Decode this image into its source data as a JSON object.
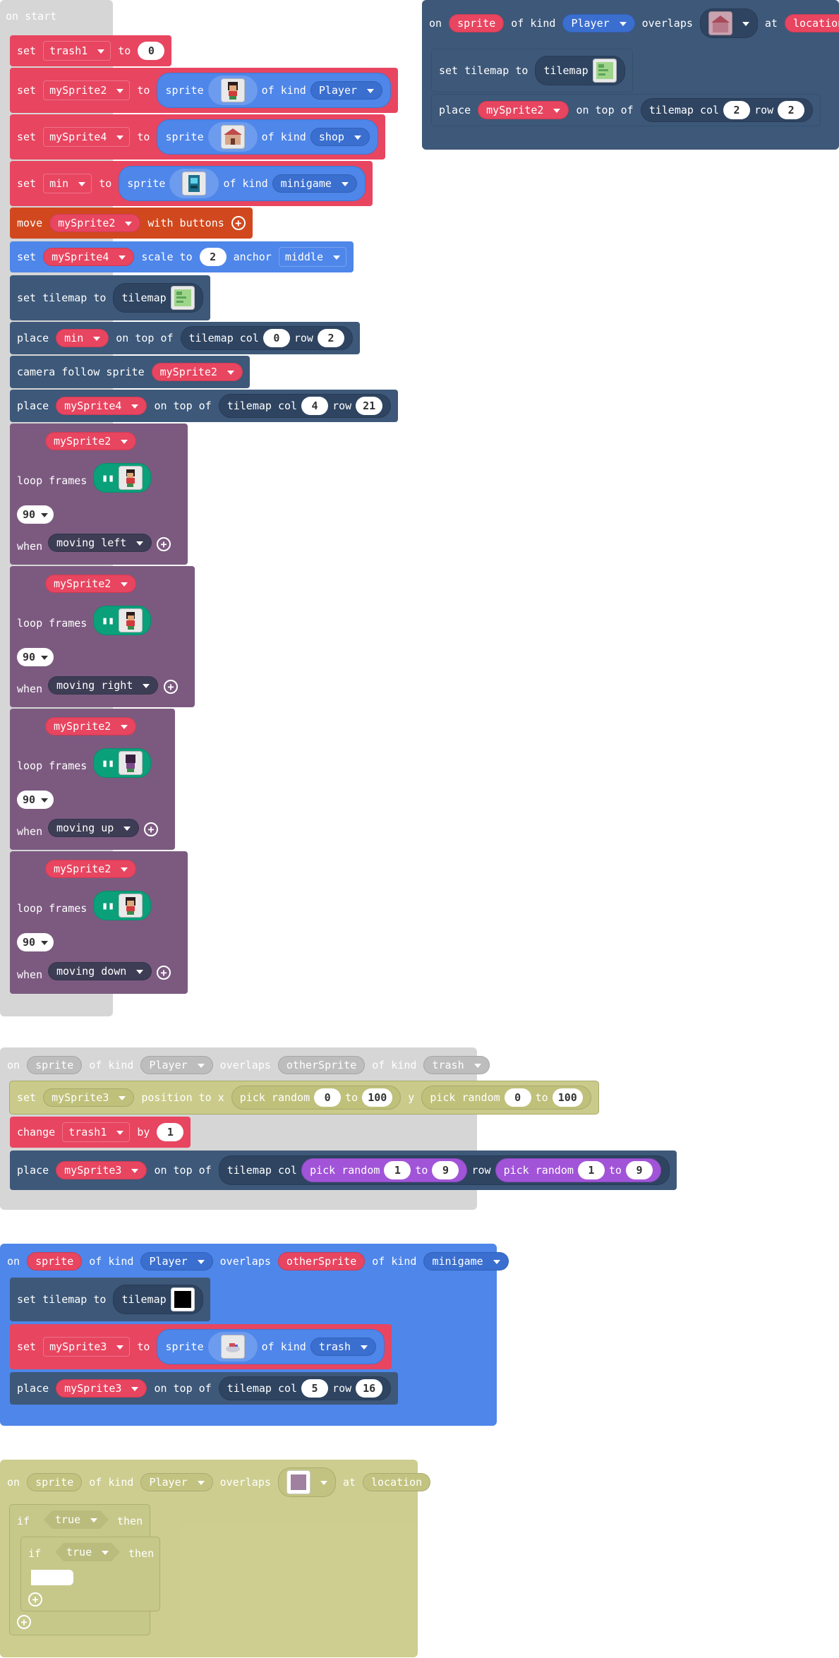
{
  "colors": {
    "red": "#e84560",
    "blue": "#4e86ea",
    "dark_blue": "#3d5879",
    "orange": "#d1481e",
    "purple": "#7c5a80",
    "green": "#0aa07a",
    "olive": "#cacb8a",
    "gray": "#d6d6d6"
  },
  "on_start": {
    "title": "on start",
    "set_trash": {
      "set": "set",
      "var": "trash1",
      "to": "to",
      "value": "0"
    },
    "set_mysprite2": {
      "set": "set",
      "var": "mySprite2",
      "to": "to",
      "sprite": "sprite",
      "of_kind": "of kind",
      "kind": "Player"
    },
    "set_mysprite4": {
      "set": "set",
      "var": "mySprite4",
      "to": "to",
      "sprite": "sprite",
      "of_kind": "of kind",
      "kind": "shop"
    },
    "set_min": {
      "set": "set",
      "var": "min",
      "to": "to",
      "sprite": "sprite",
      "of_kind": "of kind",
      "kind": "minigame"
    },
    "move": {
      "move": "move",
      "var": "mySprite2",
      "with": "with buttons"
    },
    "scale": {
      "set": "set",
      "var": "mySprite4",
      "scale_to": "scale to",
      "value": "2",
      "anchor": "anchor",
      "anchor_value": "middle"
    },
    "tilemap": {
      "label": "set tilemap to",
      "tilemap": "tilemap"
    },
    "place_min": {
      "place": "place",
      "var": "min",
      "on_top": "on top of",
      "col_label": "tilemap col",
      "col": "0",
      "row_label": "row",
      "row": "2"
    },
    "camera": {
      "label": "camera follow sprite",
      "var": "mySprite2"
    },
    "place_mysprite4": {
      "place": "place",
      "var": "mySprite4",
      "on_top": "on top of",
      "col_label": "tilemap col",
      "col": "4",
      "row_label": "row",
      "row": "21"
    },
    "animations": [
      {
        "var": "mySprite2",
        "loop": "loop frames",
        "interval": "90",
        "when": "when",
        "direction": "moving left"
      },
      {
        "var": "mySprite2",
        "loop": "loop frames",
        "interval": "90",
        "when": "when",
        "direction": "moving right"
      },
      {
        "var": "mySprite2",
        "loop": "loop frames",
        "interval": "90",
        "when": "when",
        "direction": "moving up"
      },
      {
        "var": "mySprite2",
        "loop": "loop frames",
        "interval": "90",
        "when": "when",
        "direction": "moving down"
      }
    ]
  },
  "overlap_location": {
    "on": "on",
    "sprite": "sprite",
    "of_kind": "of kind",
    "kind": "Player",
    "overlaps": "overlaps",
    "at": "at",
    "location": "location",
    "tilemap_label": "set tilemap to",
    "tilemap": "tilemap",
    "place": "place",
    "var": "mySprite2",
    "on_top": "on top of",
    "col_label": "tilemap col",
    "col": "2",
    "row_label": "row",
    "row": "2"
  },
  "overlap_trash": {
    "on": "on",
    "sprite": "sprite",
    "of_kind": "of kind",
    "kind": "Player",
    "overlaps": "overlaps",
    "other": "otherSprite",
    "kind2": "trash",
    "set": "set",
    "var": "mySprite3",
    "position_to": "position to x",
    "pick_random": "pick random",
    "x_from": "0",
    "to": "to",
    "x_to": "100",
    "y": "y",
    "y_from": "0",
    "y_to": "100",
    "change": "change",
    "change_var": "trash1",
    "by": "by",
    "change_value": "1",
    "place": "place",
    "place_var": "mySprite3",
    "on_top": "on top of",
    "col_label": "tilemap col",
    "col_from": "1",
    "col_to": "9",
    "row_label": "row",
    "row_from": "1",
    "row_to": "9"
  },
  "overlap_minigame": {
    "on": "on",
    "sprite": "sprite",
    "of_kind": "of kind",
    "kind": "Player",
    "overlaps": "overlaps",
    "other": "otherSprite",
    "kind2": "minigame",
    "tilemap_label": "set tilemap to",
    "tilemap": "tilemap",
    "set": "set",
    "var": "mySprite3",
    "to": "to",
    "sprite2": "sprite",
    "kind3": "trash",
    "place": "place",
    "place_var": "mySprite3",
    "on_top": "on top of",
    "col_label": "tilemap col",
    "col": "5",
    "row_label": "row",
    "row": "16"
  },
  "overlap_if": {
    "on": "on",
    "sprite": "sprite",
    "of_kind": "of kind",
    "kind": "Player",
    "overlaps": "overlaps",
    "at": "at",
    "location": "location",
    "if": "if",
    "cond": "true",
    "then": "then"
  }
}
